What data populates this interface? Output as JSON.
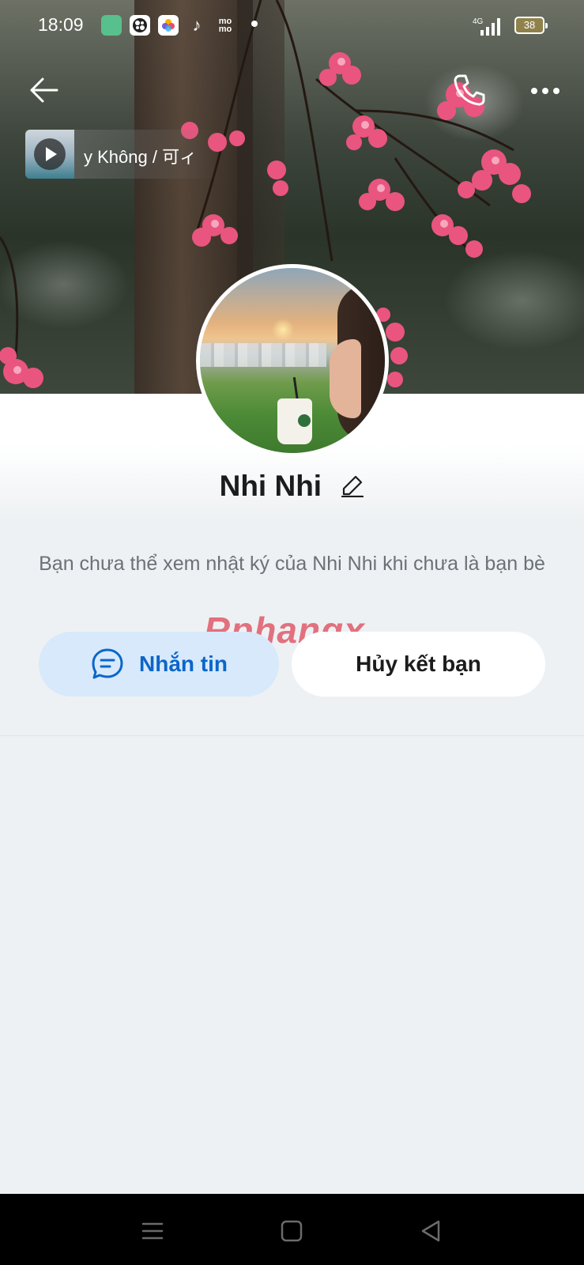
{
  "status_bar": {
    "time": "18:09",
    "app_icons": [
      "messages-app-icon",
      "mosaic-app-icon",
      "photos-app-icon",
      "tiktok-icon",
      "momo-icon"
    ],
    "momo_label": "mo\nmo",
    "network": "4G",
    "battery": "38"
  },
  "header": {
    "back_icon": "arrow-left-icon",
    "call_icon": "phone-icon",
    "more_icon": "more-horizontal-icon"
  },
  "music": {
    "title": "y Không / 可ィ",
    "play_icon": "play-icon"
  },
  "profile": {
    "name": "Nhi Nhi",
    "edit_icon": "pencil-icon"
  },
  "notice": {
    "text": "Bạn chưa thể xem nhật ký của Nhi Nhi khi chưa là bạn bè"
  },
  "watermark": {
    "part1": "Rphang",
    "part2": "x"
  },
  "actions": {
    "message_label": "Nhắn tin",
    "message_icon": "chat-bubble-icon",
    "unfriend_label": "Hủy kết bạn"
  },
  "colors": {
    "accent_blue": "#0b66c9",
    "message_button_bg": "#d7e9fb",
    "page_bg": "#eef1f3",
    "blossom_pink": "#e9557f"
  },
  "nav": {
    "menu_icon": "menu-icon",
    "home_icon": "home-square-icon",
    "back_icon": "back-triangle-icon"
  }
}
